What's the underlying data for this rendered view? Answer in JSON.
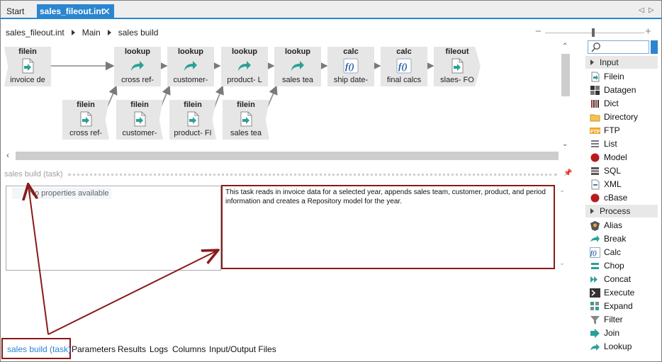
{
  "tabs": {
    "start": "Start",
    "active": "sales_fileout.int",
    "close": "✕",
    "nav_left": "◁",
    "nav_right": "▷"
  },
  "breadcrumb": [
    "sales_fileout.int",
    "Main",
    "sales build"
  ],
  "zoom": {
    "minus": "−",
    "plus": "+",
    "level": 0.58
  },
  "nodes": [
    {
      "type": "filein",
      "label": "invoice de"
    },
    {
      "type": "lookup",
      "label": "cross ref-"
    },
    {
      "type": "lookup",
      "label": "customer-"
    },
    {
      "type": "lookup",
      "label": "product- L"
    },
    {
      "type": "lookup",
      "label": "sales tea"
    },
    {
      "type": "calc",
      "label": "ship date-"
    },
    {
      "type": "calc",
      "label": "final calcs"
    },
    {
      "type": "fileout",
      "label": "slaes- FO"
    },
    {
      "type": "filein",
      "label": "cross ref-"
    },
    {
      "type": "filein",
      "label": "customer-"
    },
    {
      "type": "filein",
      "label": "product- FI"
    },
    {
      "type": "filein",
      "label": "sales tea"
    }
  ],
  "panel": {
    "title": "sales build (task)",
    "no_properties": "No properties available",
    "description": "This task reads in invoice data for a selected year, appends sales team, customer, product, and period information and creates a Repository model for the year."
  },
  "bottom_tabs": [
    "sales build (task)",
    "Parameters",
    "Results",
    "Logs",
    "Columns",
    "Input/Output Files"
  ],
  "palette": {
    "input_header": "Input",
    "input_items": [
      "Filein",
      "Datagen",
      "Dict",
      "Directory",
      "FTP",
      "List",
      "Model",
      "SQL",
      "XML",
      "cBase"
    ],
    "process_header": "Process",
    "process_items": [
      "Alias",
      "Break",
      "Calc",
      "Chop",
      "Concat",
      "Execute",
      "Expand",
      "Filter",
      "Join",
      "Lookup"
    ]
  },
  "colors": {
    "accent": "#2a86d0",
    "annotation": "#8a1a1a",
    "node_fill": "#e6e6e6",
    "arrow_teal": "#2aa198"
  }
}
